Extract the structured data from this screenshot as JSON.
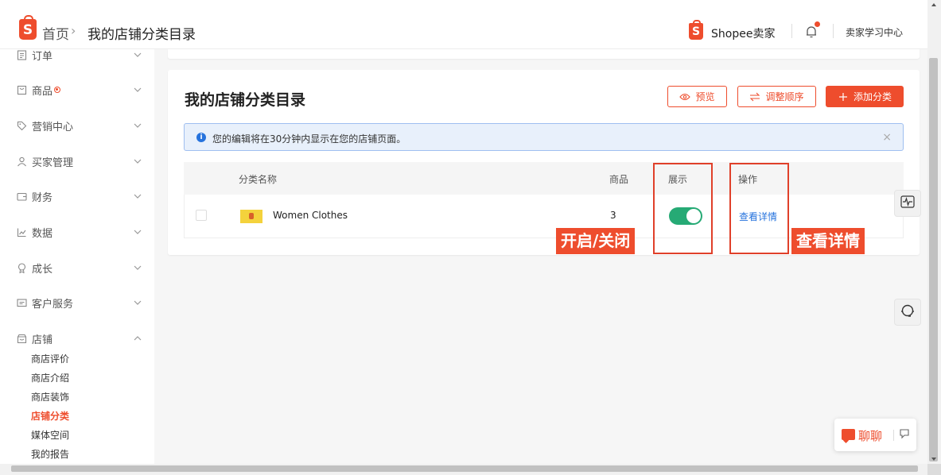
{
  "header": {
    "breadcrumb_home": "首页",
    "breadcrumb_sep": "›",
    "breadcrumb_current": "我的店铺分类目录",
    "brand": "Shopee卖家",
    "learning_center": "卖家学习中心"
  },
  "sidebar": {
    "items": [
      {
        "label": "订单",
        "icon": "order-icon",
        "expanded": false
      },
      {
        "label": "商品",
        "icon": "product-icon",
        "expanded": false,
        "badge": true
      },
      {
        "label": "营销中心",
        "icon": "tag-icon",
        "expanded": false
      },
      {
        "label": "买家管理",
        "icon": "user-icon",
        "expanded": false
      },
      {
        "label": "财务",
        "icon": "wallet-icon",
        "expanded": false
      },
      {
        "label": "数据",
        "icon": "chart-icon",
        "expanded": false
      },
      {
        "label": "成长",
        "icon": "growth-icon",
        "expanded": false
      },
      {
        "label": "客户服务",
        "icon": "message-icon",
        "expanded": false
      },
      {
        "label": "店铺",
        "icon": "shop-icon",
        "expanded": true
      }
    ],
    "shop_sub": [
      {
        "label": "商店评价",
        "active": false
      },
      {
        "label": "商店介绍",
        "active": false
      },
      {
        "label": "商店装饰",
        "active": false
      },
      {
        "label": "店铺分类",
        "active": true
      },
      {
        "label": "媒体空间",
        "active": false
      },
      {
        "label": "我的报告",
        "active": false
      }
    ]
  },
  "main": {
    "title": "我的店铺分类目录",
    "buttons": {
      "preview": "预览",
      "reorder": "调整顺序",
      "add": "添加分类"
    },
    "alert": "您的编辑将在30分钟内显示在您的店铺页面。",
    "table": {
      "headers": [
        "分类名称",
        "商品",
        "展示",
        "操作"
      ],
      "rows": [
        {
          "name": "Women Clothes",
          "count": "3",
          "shown": true,
          "action": "查看详情"
        }
      ]
    },
    "annotations": {
      "toggle_note": "开启/关闭",
      "detail_note": "查看详情"
    }
  },
  "chat": {
    "label": "聊聊"
  },
  "colors": {
    "brand": "#ee4d2d",
    "toggle_on": "#26aa75",
    "link": "#2673dd",
    "alert_bg": "#e8f0fb"
  }
}
